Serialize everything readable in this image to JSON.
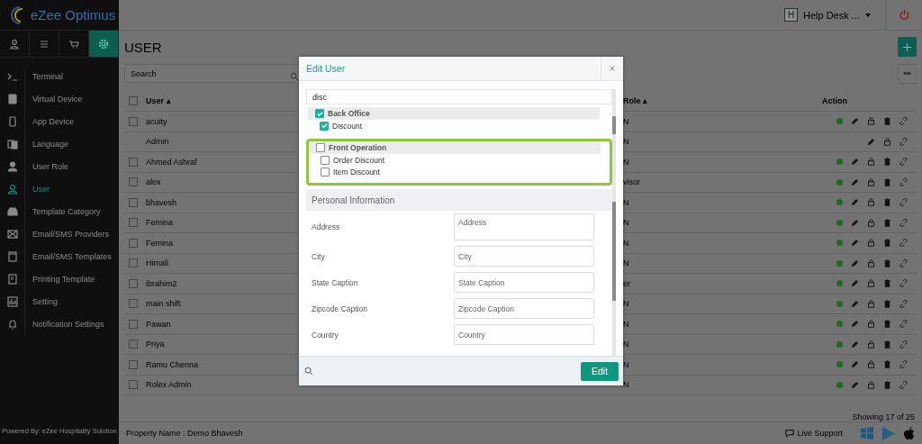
{
  "sidebar": {
    "logo": "eZee Optimus",
    "tabs": [
      {
        "selected": false
      },
      {
        "selected": false
      },
      {
        "selected": false
      },
      {
        "selected": true
      }
    ],
    "items": [
      {
        "label": "Terminal",
        "selected": false
      },
      {
        "label": "Virtual Device",
        "selected": false
      },
      {
        "label": "App Device",
        "selected": false
      },
      {
        "label": "Language",
        "selected": false
      },
      {
        "label": "User Role",
        "selected": false
      },
      {
        "label": "User",
        "selected": true
      },
      {
        "label": "Template Category",
        "selected": false
      },
      {
        "label": "Email/SMS Providers",
        "selected": false
      },
      {
        "label": "Email/SMS Templates",
        "selected": false
      },
      {
        "label": "Printing Template",
        "selected": false
      },
      {
        "label": "Setting",
        "selected": false
      },
      {
        "label": "Notification Settings",
        "selected": false
      }
    ],
    "footer": "Powered By: eZee Hospitality Solution"
  },
  "header": {
    "badge": "H",
    "desk": "Help Desk ..."
  },
  "page": {
    "title": "USER",
    "search": {
      "placeholder": "Search"
    },
    "table": {
      "select_all": {
        "checked": false
      },
      "columns": [
        {
          "label": "User",
          "sort": "▴"
        },
        {
          "label": "Role",
          "sort": "▴"
        },
        {
          "label": "Action"
        }
      ],
      "rows": [
        {
          "user": "acuity",
          "role": "N",
          "checked": false,
          "status": true,
          "deletable": true
        },
        {
          "user": "Admin",
          "role": "N",
          "status": false,
          "deletable": false
        },
        {
          "user": "Ahmed Ashraf",
          "role": "N",
          "checked": false,
          "status": true,
          "deletable": true
        },
        {
          "user": "alex",
          "role": "visor",
          "checked": false,
          "status": true,
          "deletable": true
        },
        {
          "user": "bhavesh",
          "role": "N",
          "checked": false,
          "status": true,
          "deletable": true
        },
        {
          "user": "Femina",
          "role": "N",
          "checked": false,
          "status": true,
          "deletable": true
        },
        {
          "user": "Femina",
          "role": "N",
          "checked": false,
          "status": true,
          "deletable": true
        },
        {
          "user": "Himali",
          "role": "N",
          "checked": false,
          "status": true,
          "deletable": true
        },
        {
          "user": "ibrahim2",
          "role": "er",
          "checked": false,
          "status": true,
          "deletable": true
        },
        {
          "user": "main shift",
          "role": "N",
          "checked": false,
          "status": true,
          "deletable": true
        },
        {
          "user": "Pawan",
          "role": "N",
          "checked": false,
          "status": true,
          "deletable": true
        },
        {
          "user": "Priya",
          "role": "N",
          "checked": false,
          "status": true,
          "deletable": true
        },
        {
          "user": "Ramu Chenna",
          "role": "N",
          "checked": false,
          "status": true,
          "deletable": true
        },
        {
          "user": "Rolex Admin",
          "role": "N",
          "checked": false,
          "status": true,
          "deletable": true
        }
      ]
    },
    "showing": "Showing 17 of 25"
  },
  "footer": {
    "property": "Property Name : Demo Bhavesh",
    "support": "Live Support"
  },
  "modal": {
    "title": "Edit User",
    "filter": "disc",
    "groups": [
      {
        "label": "Back Office",
        "checked": true,
        "highlighted": false,
        "children": [
          {
            "label": "Discount",
            "checked": true
          }
        ]
      },
      {
        "label": "Front Operation",
        "checked": false,
        "highlighted": true,
        "children": [
          {
            "label": "Order Discount",
            "checked": false
          },
          {
            "label": "Item Discount",
            "checked": false
          }
        ]
      }
    ],
    "section": "Personal Information",
    "fields": [
      {
        "label": "Address",
        "placeholder": "Address",
        "kind": "textarea"
      },
      {
        "label": "City",
        "placeholder": "City",
        "kind": "text"
      },
      {
        "label": "State Caption",
        "placeholder": "State Caption",
        "kind": "text"
      },
      {
        "label": "Zipcode Caption",
        "placeholder": "Zipcode Caption",
        "kind": "text"
      },
      {
        "label": "Country",
        "placeholder": "Country",
        "kind": "text"
      }
    ],
    "button": "Edit"
  }
}
